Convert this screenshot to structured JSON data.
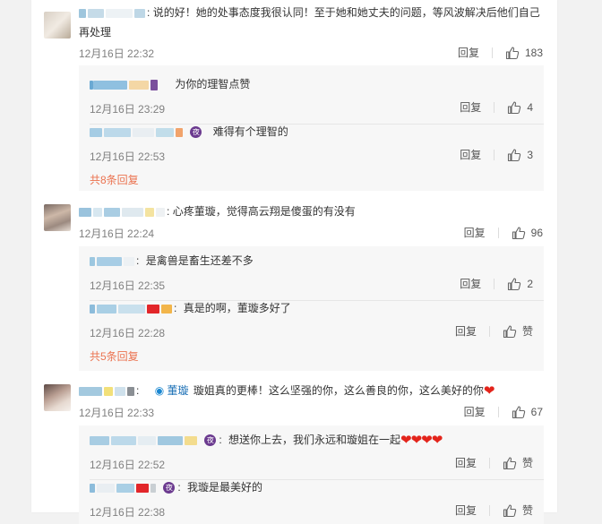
{
  "comments": [
    {
      "text": "说的好！她的处事态度我很认同！至于她和她丈夫的问题，等风波解决后他们自己再处理",
      "time": "12月16日 22:32",
      "reply_label": "回复",
      "likes": "183",
      "replies": [
        {
          "text": "为你的理智点赞",
          "time": "12月16日 23:29",
          "reply_label": "回复",
          "likes": "4"
        },
        {
          "text": "难得有个理智的",
          "time": "12月16日 22:53",
          "reply_label": "回复",
          "likes": "3"
        }
      ],
      "more": "共8条回复"
    },
    {
      "text": "心疼董璇，觉得高云翔是傻蛋的有没有",
      "time": "12月16日 22:24",
      "reply_label": "回复",
      "likes": "96",
      "replies": [
        {
          "text": "是禽兽是畜生还差不多",
          "time": "12月16日 22:35",
          "reply_label": "回复",
          "likes": "2"
        },
        {
          "text": "真是的啊，董璇多好了",
          "time": "12月16日 22:28",
          "reply_label": "回复",
          "likes": "赞"
        }
      ],
      "more": "共5条回复"
    },
    {
      "mention": "董璇",
      "text": "璇姐真的更棒！这么坚强的你，这么善良的你，这么美好的你",
      "time": "12月16日 22:33",
      "reply_label": "回复",
      "likes": "67",
      "replies": [
        {
          "text": "想送你上去，我们永远和璇姐在一起",
          "time": "12月16日 22:52",
          "reply_label": "回复",
          "likes": "赞"
        },
        {
          "text": "我璇是最美好的",
          "time": "12月16日 22:38",
          "reply_label": "回复",
          "likes": "赞"
        }
      ]
    }
  ],
  "icons": {
    "like": "thumbs-up-icon",
    "vip": "wifi-icon",
    "badge": "moon-badge-icon",
    "heart": "heart-icon"
  },
  "colors": {
    "link": "#eb7350",
    "meta": "#808080",
    "reply_bg": "#f7f7f7",
    "heart": "#e3241b"
  }
}
